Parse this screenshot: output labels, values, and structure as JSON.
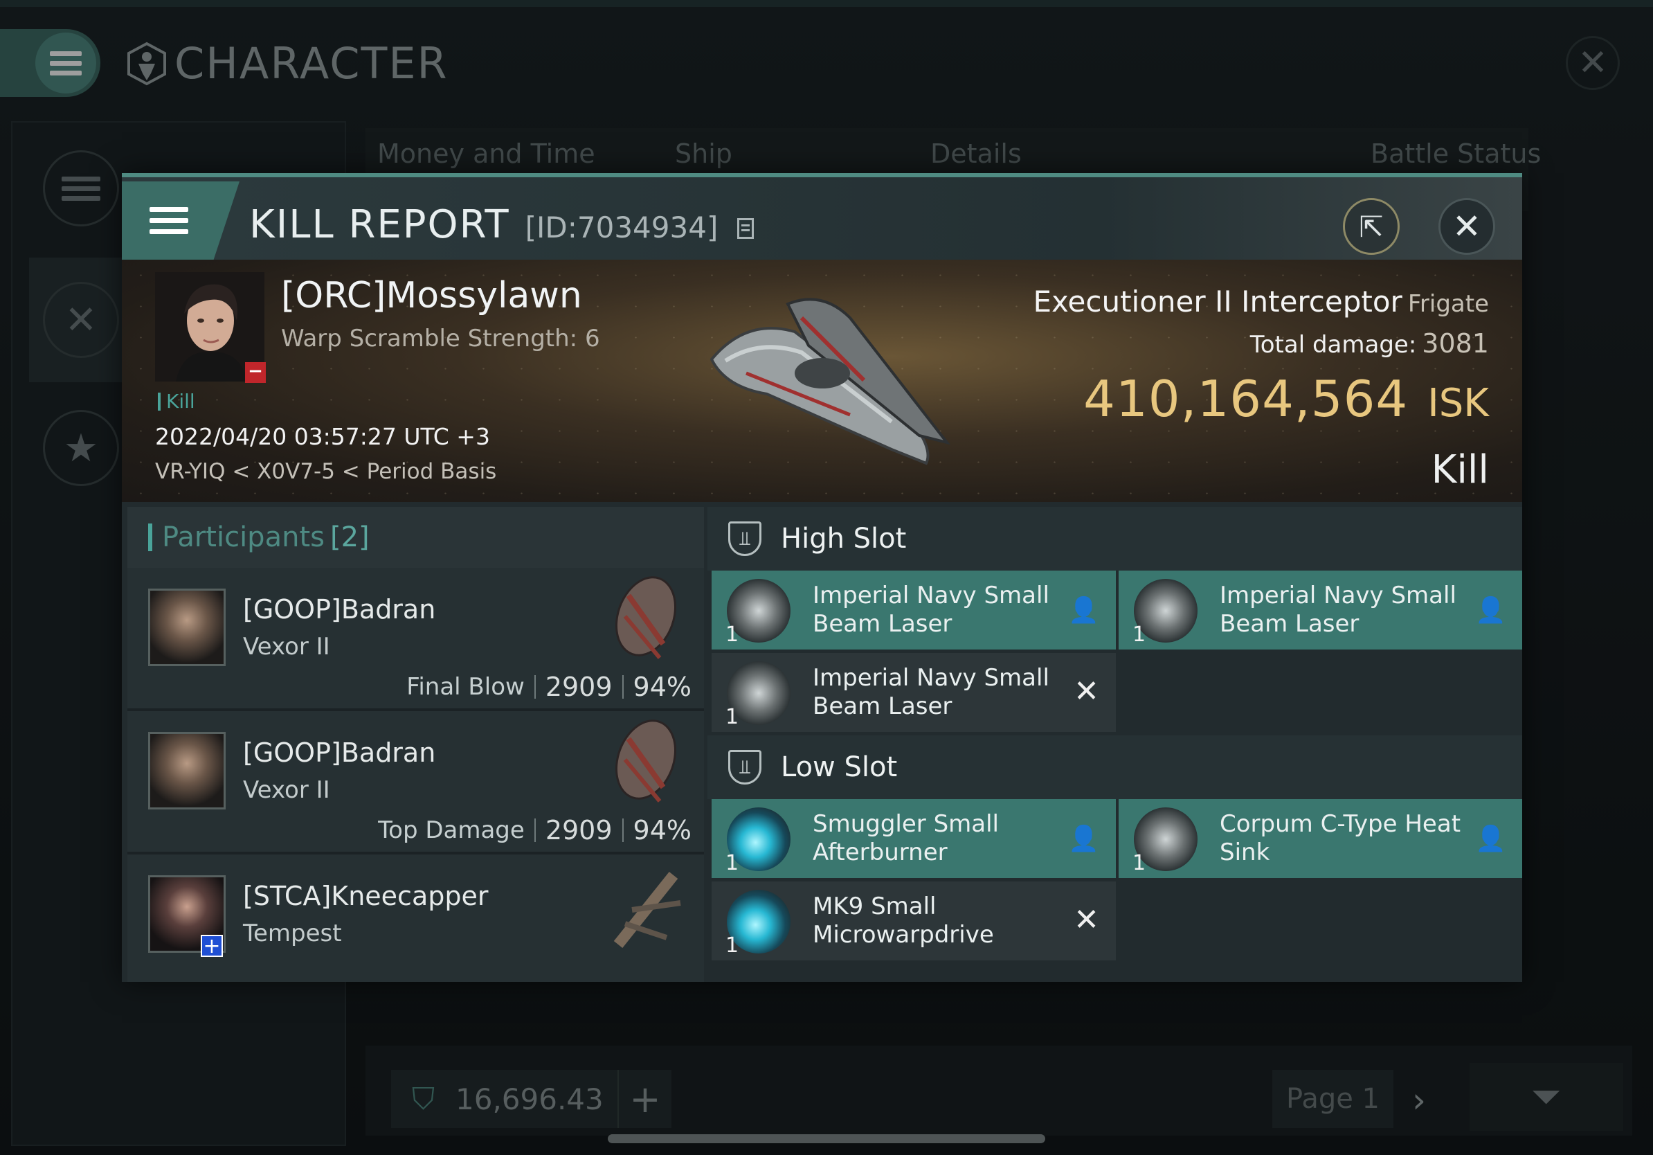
{
  "background": {
    "title": "CHARACTER",
    "tabs": [
      "Money and Time",
      "Ship",
      "Details",
      "Battle Status"
    ],
    "wallet_value": "16,696.43",
    "page_label": "Page 1"
  },
  "kill_report": {
    "title": "KILL REPORT",
    "id_label": "[ID:7034934]",
    "victim": {
      "name": "[ORC]Mossylawn",
      "subtitle": "Warp Scramble Strength: 6",
      "tag": "Kill",
      "datetime": "2022/04/20 03:57:27 UTC +3",
      "location": "VR-YIQ < X0V7-5 < Period Basis"
    },
    "ship": {
      "name": "Executioner II Interceptor",
      "class": "Frigate",
      "total_damage_label": "Total damage:",
      "total_damage": "3081",
      "isk_value": "410,164,564",
      "isk_unit": "ISK",
      "result": "Kill"
    },
    "participants": {
      "label": "Participants",
      "count": "[2]",
      "rows": [
        {
          "name": "[GOOP]Badran",
          "ship": "Vexor II",
          "role": "Final Blow",
          "damage": "2909",
          "percent": "94%"
        },
        {
          "name": "[GOOP]Badran",
          "ship": "Vexor II",
          "role": "Top Damage",
          "damage": "2909",
          "percent": "94%"
        },
        {
          "name": "[STCA]Kneecapper",
          "ship": "Tempest",
          "role": "",
          "damage": "",
          "percent": ""
        }
      ]
    },
    "fitting": {
      "high_slot_label": "High Slot",
      "low_slot_label": "Low Slot",
      "high": [
        {
          "name_line1": "Imperial Navy Small",
          "name_line2": "Beam Laser",
          "qty": "1",
          "state": "fitted"
        },
        {
          "name_line1": "Imperial Navy Small",
          "name_line2": "Beam Laser",
          "qty": "1",
          "state": "fitted"
        },
        {
          "name_line1": "Imperial Navy Small",
          "name_line2": "Beam Laser",
          "qty": "1",
          "state": "destroyed"
        }
      ],
      "low": [
        {
          "name_line1": "Smuggler Small",
          "name_line2": "Afterburner",
          "qty": "1",
          "state": "fitted"
        },
        {
          "name_line1": "Corpum C-Type Heat",
          "name_line2": "Sink",
          "qty": "1",
          "state": "fitted"
        },
        {
          "name_line1": "MK9 Small",
          "name_line2": "Microwarpdrive",
          "qty": "1",
          "state": "destroyed"
        }
      ]
    }
  }
}
